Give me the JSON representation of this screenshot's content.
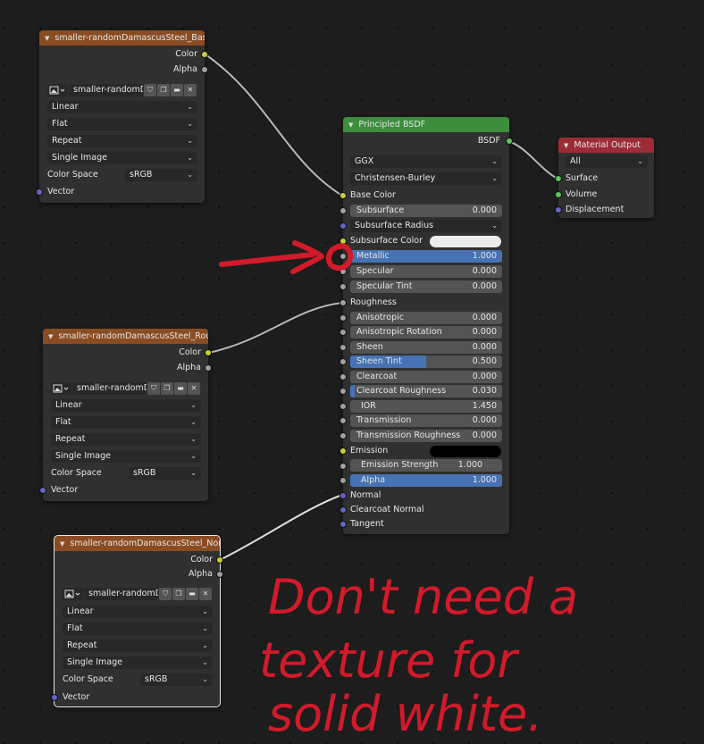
{
  "nodes": {
    "tex_base": {
      "title": "smaller-randomDamascusSteel_BaseCol",
      "out_color": "Color",
      "out_alpha": "Alpha",
      "image_name": "smaller-randomD...",
      "interpolation": "Linear",
      "projection": "Flat",
      "extension": "Repeat",
      "source": "Single Image",
      "colorspace_label": "Color Space",
      "colorspace": "sRGB",
      "in_vector": "Vector"
    },
    "tex_rough": {
      "title": "smaller-randomDamascusSteel_Rough...",
      "out_color": "Color",
      "out_alpha": "Alpha",
      "image_name": "smaller-randomD...",
      "interpolation": "Linear",
      "projection": "Flat",
      "extension": "Repeat",
      "source": "Single Image",
      "colorspace_label": "Color Space",
      "colorspace": "sRGB",
      "in_vector": "Vector"
    },
    "tex_normal": {
      "title": "smaller-randomDamascusSteel_Normal...",
      "out_color": "Color",
      "out_alpha": "Alpha",
      "image_name": "smaller-randomD...",
      "interpolation": "Linear",
      "projection": "Flat",
      "extension": "Repeat",
      "source": "Single Image",
      "colorspace_label": "Color Space",
      "colorspace": "sRGB",
      "in_vector": "Vector"
    },
    "bsdf": {
      "title": "Principled BSDF",
      "output": "BSDF",
      "distribution": "GGX",
      "subsurface_method": "Christensen-Burley",
      "base_color": "Base Color",
      "subsurface": {
        "label": "Subsurface",
        "value": "0.000"
      },
      "subsurface_radius": "Subsurface Radius",
      "subsurface_color": "Subsurface Color",
      "metallic": {
        "label": "Metallic",
        "value": "1.000",
        "fraction": 1.0
      },
      "specular": {
        "label": "Specular",
        "value": "0.000"
      },
      "specular_tint": {
        "label": "Specular Tint",
        "value": "0.000"
      },
      "roughness": "Roughness",
      "anisotropic": {
        "label": "Anisotropic",
        "value": "0.000"
      },
      "anisotropic_rotation": {
        "label": "Anisotropic Rotation",
        "value": "0.000"
      },
      "sheen": {
        "label": "Sheen",
        "value": "0.000"
      },
      "sheen_tint": {
        "label": "Sheen Tint",
        "value": "0.500",
        "fraction": 0.5
      },
      "clearcoat": {
        "label": "Clearcoat",
        "value": "0.000"
      },
      "clearcoat_roughness": {
        "label": "Clearcoat Roughness",
        "value": "0.030",
        "fraction": 0.03
      },
      "ior": {
        "label": "IOR",
        "value": "1.450"
      },
      "transmission": {
        "label": "Transmission",
        "value": "0.000"
      },
      "transmission_roughness": {
        "label": "Transmission Roughness",
        "value": "0.000"
      },
      "emission": "Emission",
      "emission_strength": {
        "label": "Emission Strength",
        "value": "1.000"
      },
      "alpha": {
        "label": "Alpha",
        "value": "1.000",
        "fraction": 1.0
      },
      "normal": "Normal",
      "clearcoat_normal": "Clearcoat Normal",
      "tangent": "Tangent"
    },
    "output": {
      "title": "Material Output",
      "target": "All",
      "surface": "Surface",
      "volume": "Volume",
      "displacement": "Displacement"
    }
  },
  "colors": {
    "subsurface_color": "#ececec",
    "emission_color": "#000000",
    "annotation": "#d11a2a"
  },
  "annotation": {
    "line1": "Don't need a",
    "line2": "texture for",
    "line3": "solid white."
  }
}
